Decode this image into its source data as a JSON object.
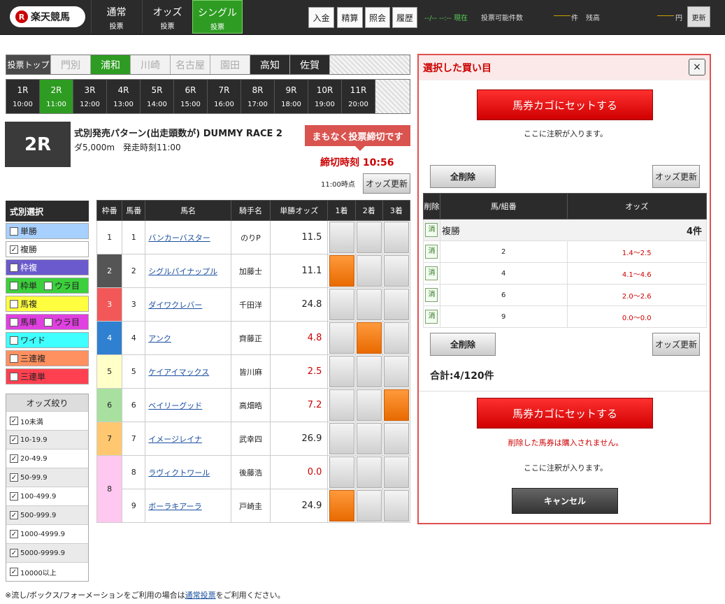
{
  "header": {
    "logo": "楽天競馬",
    "logo_mark": "R",
    "nav": [
      {
        "title": "通常",
        "sub": "投票"
      },
      {
        "title": "オッズ",
        "sub": "投票"
      },
      {
        "title": "シングル",
        "sub": "投票"
      }
    ],
    "buttons": [
      "入金",
      "精算",
      "照会",
      "履歴"
    ],
    "date_label": "--/-- --:-- 現在",
    "votable_label": "投票可能件数",
    "count_unit": "件",
    "balance_label": "残高",
    "yen_unit": "円",
    "refresh": "更新"
  },
  "tracks": {
    "top": "投票トップ",
    "items": [
      "門別",
      "浦和",
      "川崎",
      "名古屋",
      "園田",
      "高知",
      "佐賀"
    ],
    "active": "浦和"
  },
  "races": [
    {
      "n": "1R",
      "t": "10:00"
    },
    {
      "n": "2R",
      "t": "11:00"
    },
    {
      "n": "3R",
      "t": "12:00"
    },
    {
      "n": "4R",
      "t": "13:00"
    },
    {
      "n": "5R",
      "t": "14:00"
    },
    {
      "n": "6R",
      "t": "15:00"
    },
    {
      "n": "7R",
      "t": "16:00"
    },
    {
      "n": "8R",
      "t": "17:00"
    },
    {
      "n": "9R",
      "t": "18:00"
    },
    {
      "n": "10R",
      "t": "19:00"
    },
    {
      "n": "11R",
      "t": "20:00"
    }
  ],
  "race": {
    "badge": "2R",
    "title": "式別発売パターン(出走頭数が) DUMMY RACE 2",
    "sub": "ダ5,000m　発走時刻11:00",
    "closing_soon": "まもなく投票締切です",
    "deadline": "締切時刻 10:56",
    "as_of": "11:00時点",
    "odds_refresh": "オッズ更新"
  },
  "bet_types": {
    "title": "式別選択",
    "items": [
      {
        "label": "単勝",
        "color": "#a8d0ff",
        "checked": false
      },
      {
        "label": "複勝",
        "color": "#ffffff",
        "checked": true
      },
      {
        "label": "枠複",
        "color": "#6a5acd",
        "checked": false
      },
      {
        "label": "枠単",
        "extra": "ウラ目",
        "color": "#3cd03c",
        "checked": false
      },
      {
        "label": "馬複",
        "color": "#ffff40",
        "checked": false
      },
      {
        "label": "馬単",
        "extra": "ウラ目",
        "color": "#e040e0",
        "checked": false
      },
      {
        "label": "ワイド",
        "color": "#40ffff",
        "checked": false
      },
      {
        "label": "三連複",
        "color": "#ff9060",
        "checked": false
      },
      {
        "label": "三連単",
        "color": "#ff4050",
        "checked": false
      }
    ]
  },
  "odds_filter": {
    "title": "オッズ絞り",
    "items": [
      "10未満",
      "10-19.9",
      "20-49.9",
      "50-99.9",
      "100-499.9",
      "500-999.9",
      "1000-4999.9",
      "5000-9999.9",
      "10000以上"
    ]
  },
  "horse_table": {
    "headers": [
      "枠番",
      "馬番",
      "馬名",
      "騎手名",
      "単勝オッズ",
      "1着",
      "2着",
      "3着"
    ],
    "rows": [
      {
        "waku": "1",
        "num": "1",
        "name": "バンカーバスター",
        "jockey": "のりP",
        "odds": "11.5",
        "red": false,
        "sel": [
          false,
          false,
          false
        ],
        "wcolor": "#ffffff",
        "wtext": "#222"
      },
      {
        "waku": "2",
        "num": "2",
        "name": "シグルパイナップル",
        "jockey": "加藤士",
        "odds": "11.1",
        "red": false,
        "sel": [
          true,
          false,
          false
        ],
        "wcolor": "#555555",
        "wtext": "#fff"
      },
      {
        "waku": "3",
        "num": "3",
        "name": "ダイワクレバー",
        "jockey": "千田洋",
        "odds": "24.8",
        "red": false,
        "sel": [
          false,
          false,
          false
        ],
        "wcolor": "#f25858",
        "wtext": "#fff"
      },
      {
        "waku": "4",
        "num": "4",
        "name": "アンク",
        "jockey": "齊藤正",
        "odds": "4.8",
        "red": true,
        "sel": [
          false,
          true,
          false
        ],
        "wcolor": "#2f80d0",
        "wtext": "#fff"
      },
      {
        "waku": "5",
        "num": "5",
        "name": "ケイアイマックス",
        "jockey": "皆川麻",
        "odds": "2.5",
        "red": true,
        "sel": [
          false,
          false,
          false
        ],
        "wcolor": "#ffffc8",
        "wtext": "#222"
      },
      {
        "waku": "6",
        "num": "6",
        "name": "ベイリーグッド",
        "jockey": "高畑晧",
        "odds": "7.2",
        "red": true,
        "sel": [
          false,
          false,
          true
        ],
        "wcolor": "#a8e0a0",
        "wtext": "#222"
      },
      {
        "waku": "7",
        "num": "7",
        "name": "イメージレイナ",
        "jockey": "武幸四",
        "odds": "26.9",
        "red": false,
        "sel": [
          false,
          false,
          false
        ],
        "wcolor": "#ffc870",
        "wtext": "#222"
      },
      {
        "waku": "8",
        "num": "8",
        "name": "ラヴィクトワール",
        "jockey": "後藤浩",
        "odds": "0.0",
        "red": true,
        "sel": [
          false,
          false,
          false
        ],
        "wcolor": "#ffc8f0",
        "wtext": "#222"
      },
      {
        "waku": "",
        "num": "9",
        "name": "ボーラキアーラ",
        "jockey": "戸崎圭",
        "odds": "24.9",
        "red": false,
        "sel": [
          true,
          false,
          false
        ],
        "wcolor": "#ffc8f0",
        "wtext": "#222"
      }
    ]
  },
  "note": {
    "pre": "※流し/ボックス/フォーメーションをご利用の場合は",
    "link": "通常投票",
    "post": "をご利用ください。"
  },
  "panel": {
    "title": "選択した買い目",
    "close": "×",
    "set_cart": "馬券カゴにセットする",
    "notice": "ここに注釈が入ります。",
    "delete_all": "全削除",
    "odds_refresh": "オッズ更新",
    "table_head": {
      "del": "削除",
      "combo": "馬/組番",
      "odds": "オッズ"
    },
    "group": {
      "name": "複勝",
      "count": "4件"
    },
    "del_label": "消",
    "rows": [
      {
        "combo": "2",
        "odds": "1.4〜2.5"
      },
      {
        "combo": "4",
        "odds": "4.1〜4.6"
      },
      {
        "combo": "6",
        "odds": "2.0〜2.6"
      },
      {
        "combo": "9",
        "odds": "0.0〜0.0"
      }
    ],
    "total": "合計:4/120件",
    "deleted_notice": "削除した馬券は購入されません。",
    "cancel": "キャンセル"
  }
}
